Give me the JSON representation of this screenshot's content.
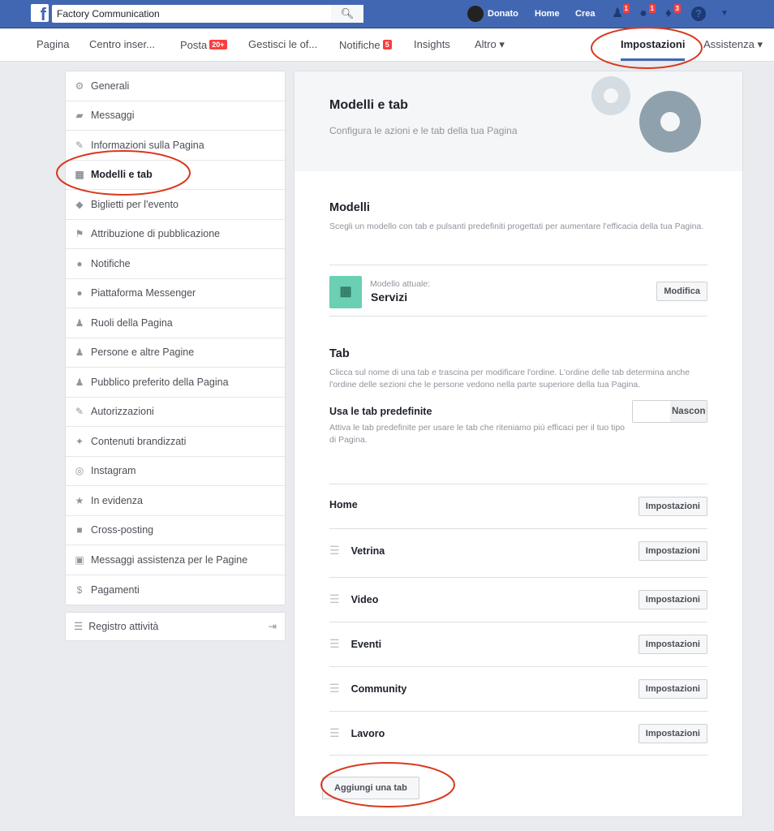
{
  "topbar": {
    "search_value": "Factory Communication",
    "user": "Donato",
    "home": "Home",
    "create": "Crea",
    "badges": {
      "friends": "1",
      "messages": "1",
      "notifications": "3"
    },
    "brand_color": "#4267b2"
  },
  "nav": {
    "items": [
      {
        "label": "Pagina"
      },
      {
        "label": "Centro inser..."
      },
      {
        "label": "Posta",
        "badge": "20+"
      },
      {
        "label": "Gestisci le of..."
      },
      {
        "label": "Notifiche",
        "badge": "5"
      },
      {
        "label": "Insights"
      },
      {
        "label": "Altro ▾"
      },
      {
        "label": "Impostazioni"
      },
      {
        "label": "Assistenza ▾"
      }
    ]
  },
  "sidebar": {
    "items": [
      {
        "label": "Generali",
        "icon": "⚙"
      },
      {
        "label": "Messaggi",
        "icon": "▰"
      },
      {
        "label": "Informazioni sulla Pagina",
        "icon": "✎"
      },
      {
        "label": "Modelli e tab",
        "icon": "▦"
      },
      {
        "label": "Biglietti per l'evento",
        "icon": "◆"
      },
      {
        "label": "Attribuzione di pubblicazione",
        "icon": "⚑"
      },
      {
        "label": "Notifiche",
        "icon": "●"
      },
      {
        "label": "Piattaforma Messenger",
        "icon": "●"
      },
      {
        "label": "Ruoli della Pagina",
        "icon": "♟"
      },
      {
        "label": "Persone e altre Pagine",
        "icon": "♟"
      },
      {
        "label": "Pubblico preferito della Pagina",
        "icon": "♟"
      },
      {
        "label": "Autorizzazioni",
        "icon": "✎"
      },
      {
        "label": "Contenuti brandizzati",
        "icon": "✦"
      },
      {
        "label": "Instagram",
        "icon": "◎"
      },
      {
        "label": "In evidenza",
        "icon": "★"
      },
      {
        "label": "Cross-posting",
        "icon": "■"
      },
      {
        "label": "Messaggi assistenza per le Pagine",
        "icon": "▣"
      },
      {
        "label": "Pagamenti",
        "icon": "$"
      }
    ],
    "activity_log": "Registro attività"
  },
  "main": {
    "title": "Modelli e tab",
    "subtitle": "Configura le azioni e le tab della tua Pagina",
    "models": {
      "title": "Modelli",
      "desc": "Scegli un modello con tab e pulsanti predefiniti progettati per aumentare l'efficacia della tua Pagina.",
      "current_label": "Modello attuale:",
      "current_value": "Servizi",
      "edit": "Modifica",
      "icon_color": "#6bcfb4"
    },
    "tabs": {
      "title": "Tab",
      "desc": "Clicca sul nome di una tab e trascina per modificare l'ordine. L'ordine delle tab determina anche l'ordine delle sezioni che le persone vedono nella parte superiore della tua Pagina.",
      "default_title": "Usa le tab predefinite",
      "default_desc": "Attiva le tab predefinite per usare le tab che riteniamo più efficaci per il tuo tipo di Pagina.",
      "toggle_label": "Nascon",
      "rows": [
        {
          "name": "Home"
        },
        {
          "name": "Vetrina"
        },
        {
          "name": "Video"
        },
        {
          "name": "Eventi"
        },
        {
          "name": "Community"
        },
        {
          "name": "Lavoro"
        }
      ],
      "settings": "Impostazioni",
      "add": "Aggiungi una tab"
    }
  }
}
